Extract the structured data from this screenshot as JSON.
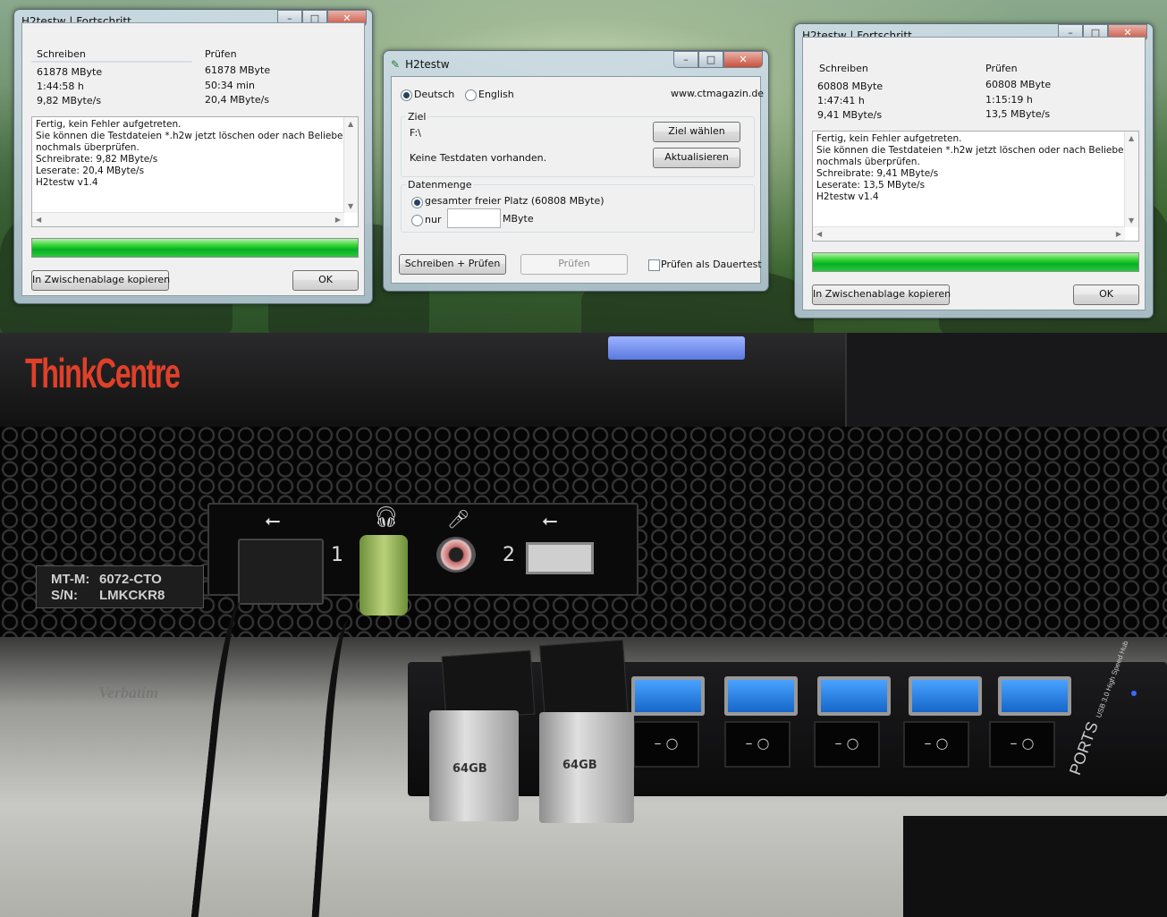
{
  "window_left": {
    "title": "H2testw | Fortschritt",
    "controls": {
      "minimize": "–",
      "maximize": "□",
      "close": "✕"
    },
    "write": {
      "label": "Schreiben",
      "size": "61878 MByte",
      "time": "1:44:58 h",
      "rate": "9,82 MByte/s"
    },
    "verify": {
      "label": "Prüfen",
      "size": "61878 MByte",
      "time": "50:34 min",
      "rate": "20,4 MByte/s"
    },
    "log": [
      "Fertig, kein Fehler aufgetreten.",
      "Sie können die Testdateien *.h2w jetzt löschen oder nach Belieben",
      "nochmals überprüfen.",
      "Schreibrate: 9,82 MByte/s",
      "Leserate: 20,4 MByte/s",
      "H2testw v1.4"
    ],
    "progress": 1.0,
    "copy_button": "In Zwischenablage kopieren",
    "ok_button": "OK"
  },
  "window_center": {
    "title": "H2testw",
    "controls": {
      "minimize": "–",
      "maximize": "□",
      "close": "✕"
    },
    "lang_de": "Deutsch",
    "lang_en": "English",
    "website": "www.ctmagazin.de",
    "target_group": "Ziel",
    "target_path": "F:\\",
    "choose_target": "Ziel wählen",
    "no_testdata": "Keine Testdaten vorhanden.",
    "refresh": "Aktualisieren",
    "amount_group": "Datenmenge",
    "all_space": "gesamter freier Platz (60808 MByte)",
    "only": "nur",
    "only_value": "",
    "mbyte": "MByte",
    "write_verify": "Schreiben + Prüfen",
    "verify": "Prüfen",
    "endless": "Prüfen als Dauertest"
  },
  "window_right": {
    "title": "H2testw | Fortschritt",
    "controls": {
      "minimize": "–",
      "maximize": "□",
      "close": "✕"
    },
    "write": {
      "label": "Schreiben",
      "size": "60808 MByte",
      "time": "1:47:41 h",
      "rate": "9,41 MByte/s"
    },
    "verify": {
      "label": "Prüfen",
      "size": "60808 MByte",
      "time": "1:15:19 h",
      "rate": "13,5 MByte/s"
    },
    "log": [
      "Fertig, kein Fehler aufgetreten.",
      "Sie können die Testdateien *.h2w jetzt löschen oder nach Belieben",
      "nochmals überprüfen.",
      "Schreibrate: 9,41 MByte/s",
      "Leserate: 13,5 MByte/s",
      "H2testw v1.4"
    ],
    "progress": 1.0,
    "copy_button": "In Zwischenablage kopieren",
    "ok_button": "OK"
  },
  "photo": {
    "brand": "ThinkCentre",
    "mtm_label": "MT-M:",
    "mtm_value": "6072-CTO",
    "sn_label": "S/N:",
    "sn_value": "LMKCKR8",
    "port1": "1",
    "port2": "2",
    "usb_symbol": "⭠",
    "stick1": "64GB",
    "stick2": "64GB",
    "hub_text": "PORTS",
    "hub_sub": "USB 3.0 High Speed Hub",
    "verbatim": "Verbatim"
  }
}
